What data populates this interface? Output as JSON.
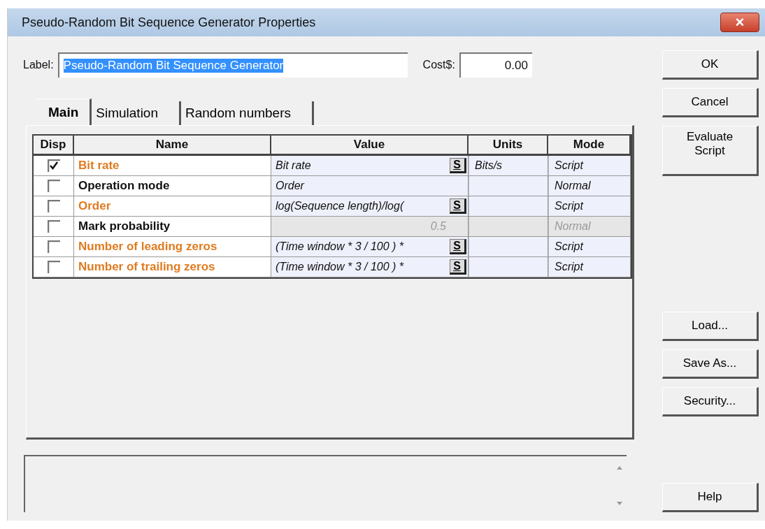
{
  "window": {
    "title": "Pseudo-Random Bit Sequence Generator Properties",
    "close": "×"
  },
  "label_field": {
    "label": "Label:",
    "value": "Pseudo-Random Bit Sequence Generator"
  },
  "cost_field": {
    "label": "Cost$:",
    "value": "0.00"
  },
  "tabs": [
    {
      "label": "Main",
      "selected": true
    },
    {
      "label": "Simulation",
      "selected": false
    },
    {
      "label": "Random numbers",
      "selected": false
    }
  ],
  "table": {
    "columns": [
      "Disp",
      "Name",
      "Value",
      "Units",
      "Mode"
    ],
    "rows": [
      {
        "disp": true,
        "name": "Bit rate",
        "kind": "script",
        "value": "Bit rate",
        "button": "S",
        "units": "Bits/s",
        "mode": "Script",
        "disabled": false
      },
      {
        "disp": false,
        "name": "Operation mode",
        "kind": "normal",
        "value": "Order",
        "units": "",
        "mode": "Normal",
        "disabled": false
      },
      {
        "disp": false,
        "name": "Order",
        "kind": "script",
        "value": "log(Sequence length)/log(",
        "button": "S",
        "units": "",
        "mode": "Script",
        "disabled": false
      },
      {
        "disp": false,
        "name": "Mark probability",
        "kind": "normal",
        "value": "0.5",
        "units": "",
        "mode": "Normal",
        "disabled": true
      },
      {
        "disp": false,
        "name": "Number of leading zeros",
        "kind": "script",
        "value": "(Time window * 3 / 100 ) *",
        "button": "S",
        "units": "",
        "mode": "Script",
        "disabled": false
      },
      {
        "disp": false,
        "name": "Number of trailing zeros",
        "kind": "script",
        "value": "(Time window * 3 / 100 ) *",
        "button": "S",
        "units": "",
        "mode": "Script",
        "disabled": false
      }
    ]
  },
  "buttons_top": [
    "OK",
    "Cancel",
    "Evaluate Script"
  ],
  "buttons_middle": [
    "Load...",
    "Save As...",
    "Security..."
  ],
  "help_button": "Help"
}
